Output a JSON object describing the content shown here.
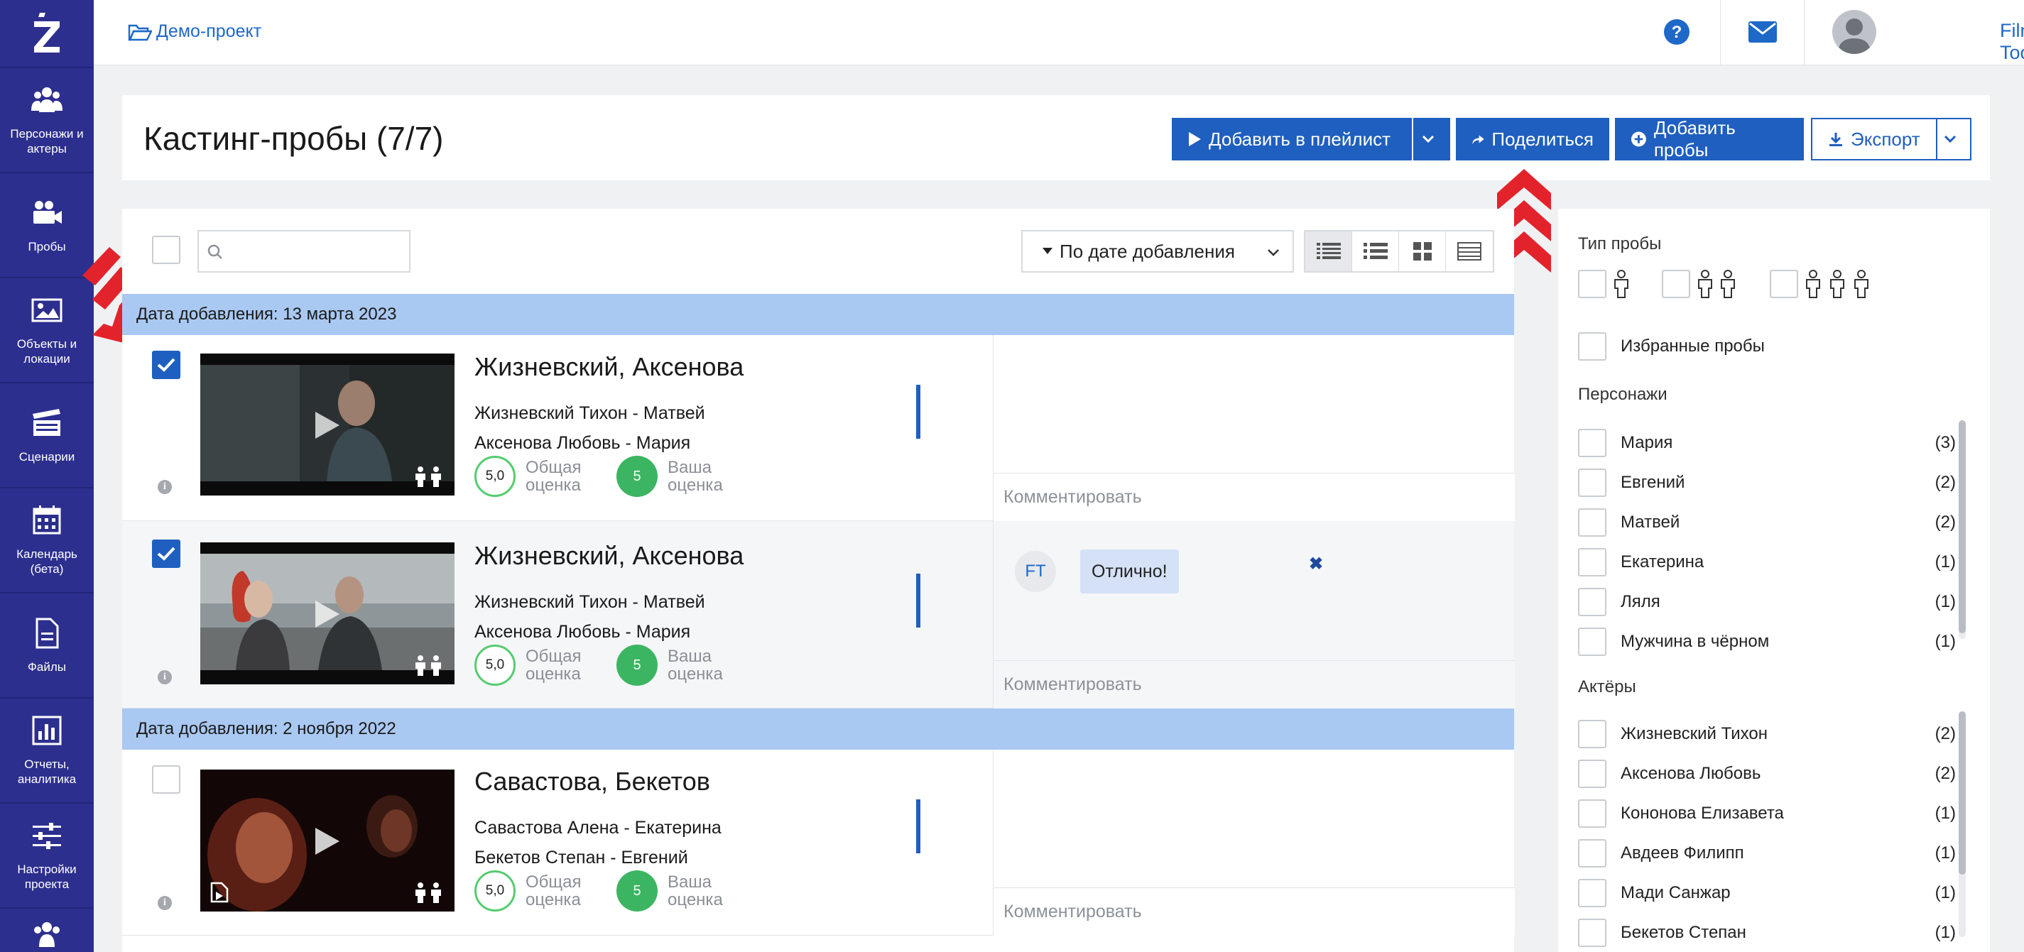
{
  "sidebar": {
    "items": [
      {
        "label": "Персонажи и\nактеры",
        "icon": "people-icon"
      },
      {
        "label": "Пробы",
        "icon": "video-camera-icon"
      },
      {
        "label": "Объекты и\nлокации",
        "icon": "image-icon"
      },
      {
        "label": "Сценарии",
        "icon": "clapperboard-icon"
      },
      {
        "label": "Календарь\n(бета)",
        "icon": "calendar-icon"
      },
      {
        "label": "Файлы",
        "icon": "file-icon"
      },
      {
        "label": "Отчеты,\nаналитика",
        "icon": "chart-icon"
      },
      {
        "label": "Настройки\nпроекта",
        "icon": "sliders-icon"
      }
    ]
  },
  "topbar": {
    "breadcrumb": "Демо-проект",
    "user_name": "Film Toolz"
  },
  "header": {
    "title": "Кастинг-пробы (7/7)",
    "btn_playlist": "Добавить в плейлист",
    "btn_share": "Поделиться",
    "btn_add": "Добавить пробы",
    "btn_export": "Экспорт"
  },
  "toolbar": {
    "search_placeholder": "",
    "sort_label": "По дате добавления"
  },
  "groups": [
    {
      "date_label": "Дата добавления: 13 марта 2023"
    },
    {
      "date_label": "Дата добавления: 2 ноября 2022"
    }
  ],
  "rows": [
    {
      "title": "Жизневский, Аксенова",
      "line1": "Жизневский Тихон - Матвей",
      "line2": "Аксенова Любовь - Мария",
      "overall_score": "5,0",
      "overall_label": "Общая\nоценка",
      "your_score": "5",
      "your_label": "Ваша\nоценка",
      "comment_placeholder": "Комментировать",
      "checked": true
    },
    {
      "title": "Жизневский, Аксенова",
      "line1": "Жизневский Тихон - Матвей",
      "line2": "Аксенова Любовь - Мария",
      "overall_score": "5,0",
      "overall_label": "Общая\nоценка",
      "your_score": "5",
      "your_label": "Ваша\nоценка",
      "comment_author": "FT",
      "comment_text": "Отлично!",
      "comment_placeholder": "Комментировать",
      "checked": true
    },
    {
      "title": "Савастова, Бекетов",
      "line1": "Савастова Алена - Екатерина",
      "line2": "Бекетов Степан - Евгений",
      "overall_score": "5,0",
      "overall_label": "Общая\nоценка",
      "your_score": "5",
      "your_label": "Ваша\nоценка",
      "comment_placeholder": "Комментировать",
      "checked": false
    }
  ],
  "filters": {
    "type_heading": "Тип пробы",
    "favorites": "Избранные пробы",
    "characters_heading": "Персонажи",
    "characters": [
      {
        "name": "Мария",
        "count": "(3)"
      },
      {
        "name": "Евгений",
        "count": "(2)"
      },
      {
        "name": "Матвей",
        "count": "(2)"
      },
      {
        "name": "Екатерина",
        "count": "(1)"
      },
      {
        "name": "Ляля",
        "count": "(1)"
      },
      {
        "name": "Мужчина в чёрном",
        "count": "(1)"
      }
    ],
    "actors_heading": "Актёры",
    "actors": [
      {
        "name": "Жизневский Тихон",
        "count": "(2)"
      },
      {
        "name": "Аксенова Любовь",
        "count": "(2)"
      },
      {
        "name": "Кононова Елизавета",
        "count": "(1)"
      },
      {
        "name": "Авдеев Филипп",
        "count": "(1)"
      },
      {
        "name": "Мади Санжар",
        "count": "(1)"
      },
      {
        "name": "Бекетов Степан",
        "count": "(1)"
      }
    ]
  },
  "colors": {
    "sidebar": "#2d2f8e",
    "accent": "#1f5fbf",
    "date_bar": "#a9c8f2",
    "score_green": "#3bb562"
  }
}
